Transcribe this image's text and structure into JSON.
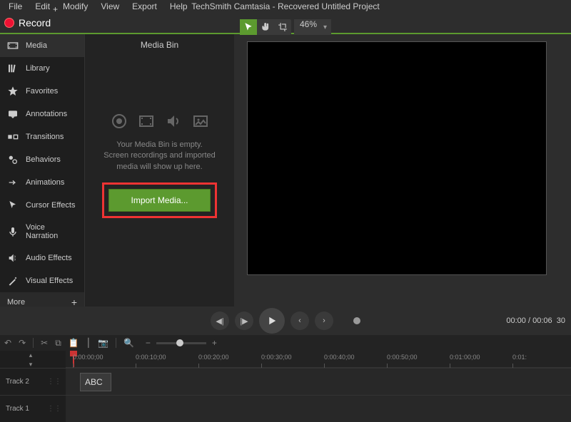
{
  "menu": {
    "file": "File",
    "edit": "Edit",
    "modify": "Modify",
    "view": "View",
    "export": "Export",
    "help": "Help"
  },
  "title": "TechSmith Camtasia - Recovered  Untitled Project",
  "record": "Record",
  "zoom": "46%",
  "sidebar": {
    "items": [
      {
        "label": "Media"
      },
      {
        "label": "Library"
      },
      {
        "label": "Favorites"
      },
      {
        "label": "Annotations"
      },
      {
        "label": "Transitions"
      },
      {
        "label": "Behaviors"
      },
      {
        "label": "Animations"
      },
      {
        "label": "Cursor Effects"
      },
      {
        "label": "Voice Narration"
      },
      {
        "label": "Audio Effects"
      },
      {
        "label": "Visual Effects"
      }
    ],
    "more": "More"
  },
  "mediabin": {
    "title": "Media Bin",
    "empty": "Your Media Bin is empty.\nScreen recordings and imported\nmedia will show up here.",
    "import": "Import Media..."
  },
  "playback": {
    "time": "00:00 / 00:06",
    "fps": "30"
  },
  "timeline": {
    "playhead": "0:00:00;00",
    "ticks": [
      "0:00:00;00",
      "0:00:10;00",
      "0:00:20;00",
      "0:00:30;00",
      "0:00:40;00",
      "0:00:50;00",
      "0:01:00;00",
      "0:01:"
    ],
    "tracks": [
      {
        "name": "Track 2"
      },
      {
        "name": "Track 1"
      }
    ],
    "clip": "ABC"
  }
}
